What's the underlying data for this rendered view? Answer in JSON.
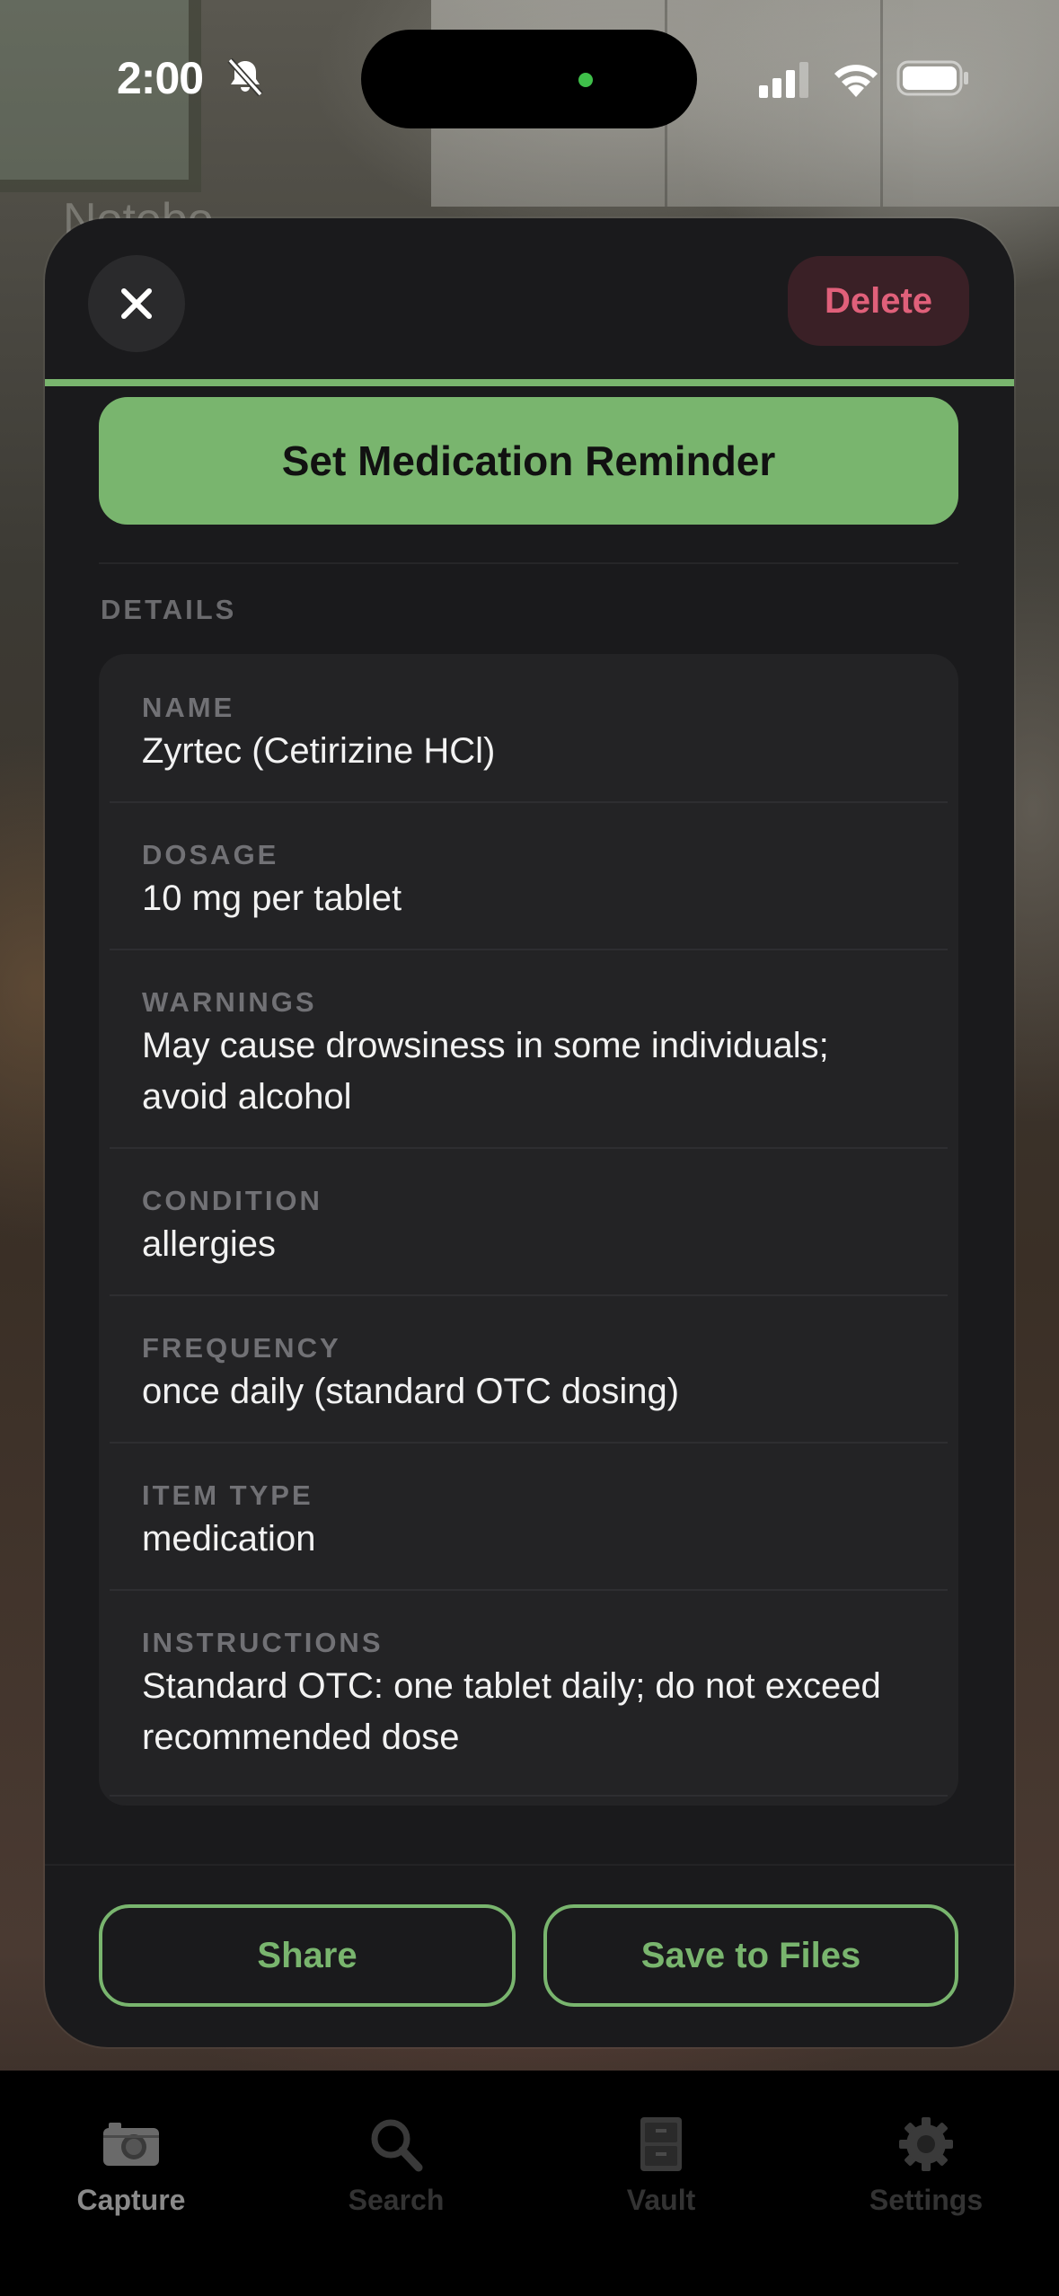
{
  "status_bar": {
    "time": "2:00"
  },
  "background": {
    "text": "Notebo"
  },
  "header": {
    "close_icon": "close-icon",
    "delete_label": "Delete"
  },
  "reminder_button": {
    "label": "Set Medication Reminder"
  },
  "details": {
    "heading": "DETAILS",
    "rows": [
      {
        "label": "NAME",
        "value": "Zyrtec (Cetirizine HCl)"
      },
      {
        "label": "DOSAGE",
        "value": "10 mg per tablet"
      },
      {
        "label": "WARNINGS",
        "value": "May cause drowsiness in some individuals; avoid alcohol"
      },
      {
        "label": "CONDITION",
        "value": "allergies"
      },
      {
        "label": "FREQUENCY",
        "value": "once daily (standard OTC dosing)"
      },
      {
        "label": "ITEM TYPE",
        "value": "medication"
      },
      {
        "label": "INSTRUCTIONS",
        "value": "Standard OTC: one tablet daily; do not exceed recommended dose"
      }
    ]
  },
  "actions": {
    "share_label": "Share",
    "save_label": "Save to Files"
  },
  "tabbar": {
    "items": [
      {
        "label": "Capture",
        "icon": "camera-icon",
        "active": true
      },
      {
        "label": "Search",
        "icon": "search-icon",
        "active": false
      },
      {
        "label": "Vault",
        "icon": "cabinet-icon",
        "active": false
      },
      {
        "label": "Settings",
        "icon": "gear-icon",
        "active": false
      }
    ]
  },
  "colors": {
    "accent": "#79b56e",
    "delete": "#e0607a",
    "sheet_bg": "#1a1a1c",
    "card_bg": "#232325"
  }
}
